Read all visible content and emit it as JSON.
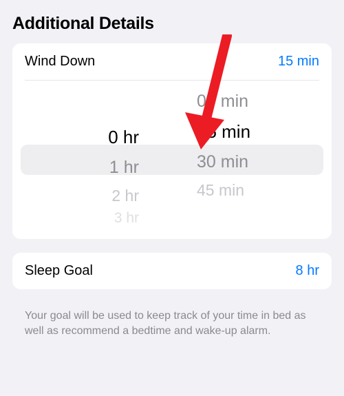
{
  "section_title": "Additional Details",
  "wind_down": {
    "label": "Wind Down",
    "value": "15 min",
    "picker": {
      "hours": {
        "selected": "0 hr",
        "below1": "1 hr",
        "below2": "2 hr",
        "below3": "3 hr"
      },
      "minutes": {
        "above1": "00 min",
        "selected": "15 min",
        "below1": "30 min",
        "below2": "45 min"
      }
    }
  },
  "sleep_goal": {
    "label": "Sleep Goal",
    "value": "8 hr",
    "footer": "Your goal will be used to keep track of your time in bed as well as recommend a bedtime and wake-up alarm."
  }
}
